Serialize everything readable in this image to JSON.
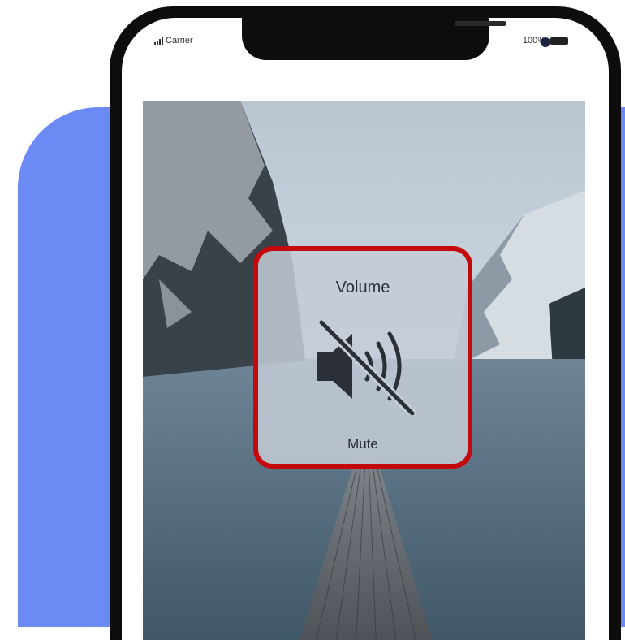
{
  "status_bar": {
    "carrier": "Carrier",
    "battery_percent": "100%"
  },
  "volume_hud": {
    "title": "Volume",
    "status": "Mute",
    "icon": "speaker-muted-icon"
  },
  "colors": {
    "background_accent": "#6b8af3",
    "highlight_border": "#c4090d",
    "phone_frame": "#0d0d0d"
  }
}
